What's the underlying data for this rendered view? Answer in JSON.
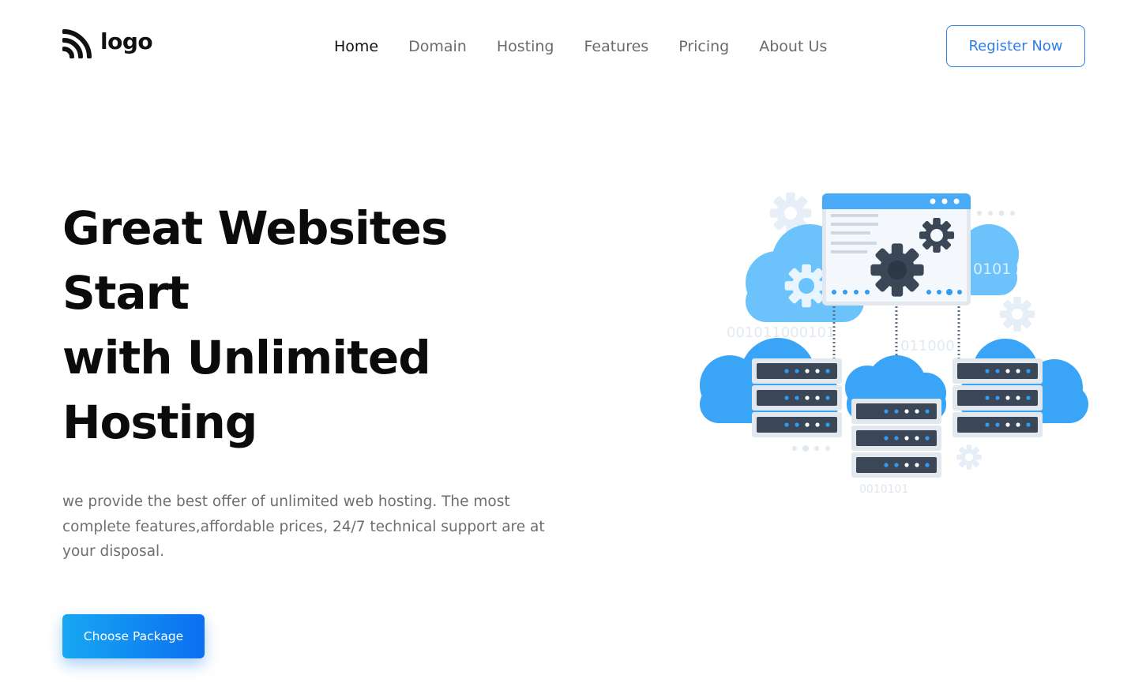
{
  "brand": {
    "logo_text": "logo"
  },
  "nav": {
    "items": [
      {
        "label": "Home",
        "active": true
      },
      {
        "label": "Domain",
        "active": false
      },
      {
        "label": "Hosting",
        "active": false
      },
      {
        "label": "Features",
        "active": false
      },
      {
        "label": "Pricing",
        "active": false
      },
      {
        "label": "About Us",
        "active": false
      }
    ],
    "register_label": "Register Now"
  },
  "hero": {
    "title_lines": [
      "Great Websites",
      "Start",
      "with Unlimited",
      "Hosting"
    ],
    "description": "we provide the best offer of unlimited web hosting. The most complete features,affordable prices, 24/7 technical support are at your disposal.",
    "cta_label": "Choose Package"
  },
  "illustration": {
    "binary_1": "0101",
    "binary_2": "001011000101",
    "binary_3": "011000",
    "binary_4": "0010101"
  },
  "colors": {
    "accent": "#2f7de6",
    "cta_start": "#17a8f2",
    "cta_end": "#0c6ff0",
    "cloud": "#4fb3f7",
    "server": "#3b4656",
    "heading": "#0b0b0b",
    "body_text": "#6e6e6e"
  }
}
